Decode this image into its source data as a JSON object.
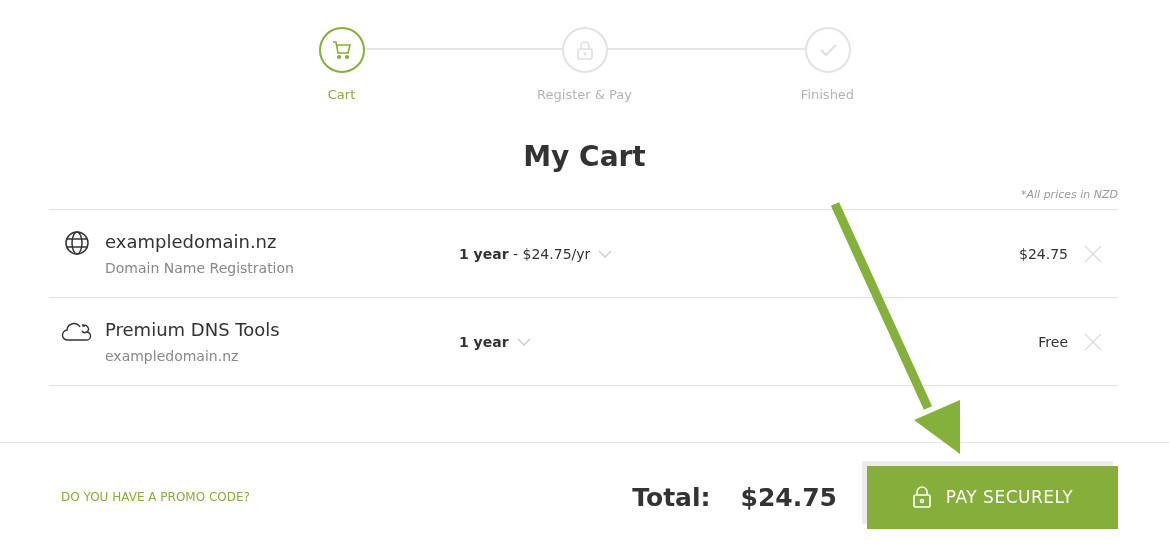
{
  "steps": [
    {
      "label": "Cart",
      "selected": true,
      "kind": "cart"
    },
    {
      "label": "Register & Pay",
      "selected": false,
      "kind": "lock"
    },
    {
      "label": "Finished",
      "selected": false,
      "kind": "check"
    }
  ],
  "title": "My Cart",
  "price_note": "*All prices in NZD",
  "items": [
    {
      "kind": "domain",
      "name": "exampledomain.nz",
      "subtitle": "Domain Name Registration",
      "term": "**1 year** - $24.75/yr",
      "price": "$24.75"
    },
    {
      "kind": "service",
      "name": "Premium DNS Tools",
      "subtitle": "exampledomain.nz",
      "term": "**1 year**",
      "price": "Free"
    }
  ],
  "footer": {
    "promo_link": "DO YOU HAVE A PROMO CODE?",
    "total_label": "Total:",
    "total_value": "$24.75",
    "pay_button": "PAY SECURELY"
  }
}
